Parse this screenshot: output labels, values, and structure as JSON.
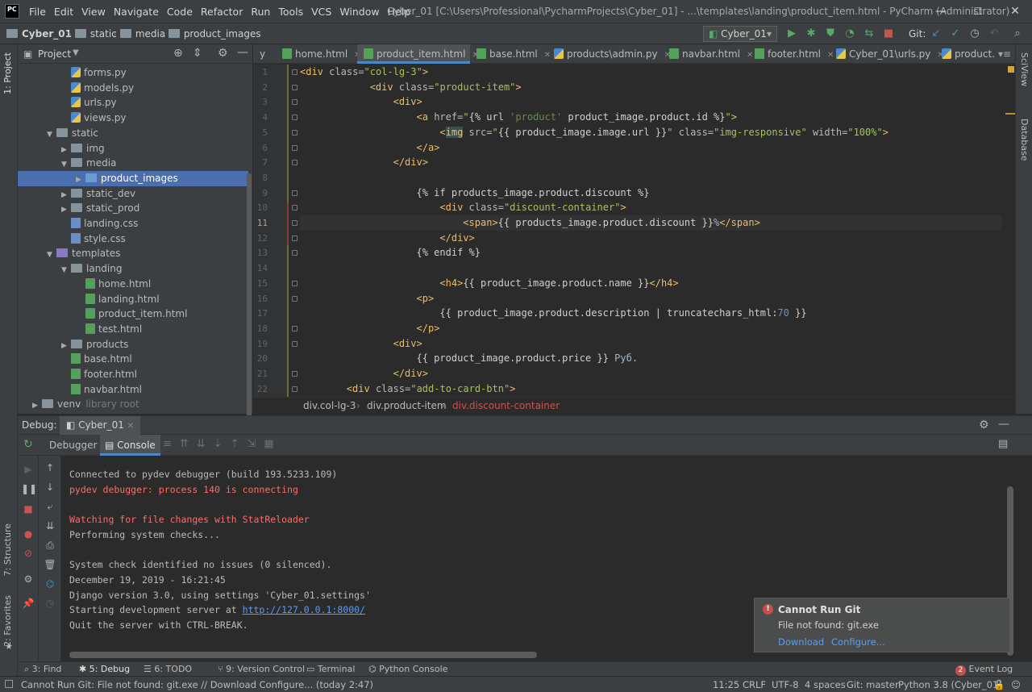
{
  "window": {
    "logo": "PC",
    "title": "Cyber_01 [C:\\Users\\Professional\\PycharmProjects\\Cyber_01] - ...\\templates\\landing\\product_item.html - PyCharm (Administrator)",
    "menu": [
      "File",
      "Edit",
      "View",
      "Navigate",
      "Code",
      "Refactor",
      "Run",
      "Tools",
      "VCS",
      "Window",
      "Help"
    ],
    "controls": {
      "minimize": "—",
      "maximize": "☐",
      "close": "✕"
    }
  },
  "navbar": {
    "crumbs": [
      "Cyber_01",
      "static",
      "media",
      "product_images"
    ],
    "run_config": "Cyber_01",
    "git_label": "Git:"
  },
  "left_strip": {
    "project_tab": "1: Project",
    "structure_tab": "7: Structure",
    "favorites_tab": "2: Favorites"
  },
  "right_strip": {
    "sciview_tab": "SciView",
    "database_tab": "Database"
  },
  "project": {
    "header": "Project",
    "tree": [
      {
        "label": "forms.py",
        "type": "py",
        "indent": 2,
        "arrow": ""
      },
      {
        "label": "models.py",
        "type": "py",
        "indent": 2,
        "arrow": ""
      },
      {
        "label": "urls.py",
        "type": "py",
        "indent": 2,
        "arrow": ""
      },
      {
        "label": "views.py",
        "type": "py",
        "indent": 2,
        "arrow": ""
      },
      {
        "label": "static",
        "type": "folder",
        "indent": 1,
        "arrow": "▼"
      },
      {
        "label": "img",
        "type": "folder",
        "indent": 2,
        "arrow": "▶"
      },
      {
        "label": "media",
        "type": "folder",
        "indent": 2,
        "arrow": "▼"
      },
      {
        "label": "product_images",
        "type": "folder-blue",
        "indent": 3,
        "arrow": "▶",
        "selected": true
      },
      {
        "label": "static_dev",
        "type": "folder",
        "indent": 2,
        "arrow": "▶"
      },
      {
        "label": "static_prod",
        "type": "folder",
        "indent": 2,
        "arrow": "▶"
      },
      {
        "label": "landing.css",
        "type": "css",
        "indent": 2,
        "arrow": ""
      },
      {
        "label": "style.css",
        "type": "css",
        "indent": 2,
        "arrow": ""
      },
      {
        "label": "templates",
        "type": "folder-purple",
        "indent": 1,
        "arrow": "▼"
      },
      {
        "label": "landing",
        "type": "folder",
        "indent": 2,
        "arrow": "▼"
      },
      {
        "label": "home.html",
        "type": "html",
        "indent": 3,
        "arrow": ""
      },
      {
        "label": "landing.html",
        "type": "html",
        "indent": 3,
        "arrow": ""
      },
      {
        "label": "product_item.html",
        "type": "html",
        "indent": 3,
        "arrow": ""
      },
      {
        "label": "test.html",
        "type": "html",
        "indent": 3,
        "arrow": ""
      },
      {
        "label": "products",
        "type": "folder",
        "indent": 2,
        "arrow": "▶"
      },
      {
        "label": "base.html",
        "type": "html",
        "indent": 2,
        "arrow": ""
      },
      {
        "label": "footer.html",
        "type": "html",
        "indent": 2,
        "arrow": ""
      },
      {
        "label": "navbar.html",
        "type": "html",
        "indent": 2,
        "arrow": ""
      },
      {
        "label": "venv",
        "type": "folder",
        "indent": 0,
        "arrow": "▶",
        "suffix": "library root"
      }
    ]
  },
  "editor": {
    "tabs": [
      {
        "label": "y",
        "active": false
      },
      {
        "label": "home.html",
        "active": false
      },
      {
        "label": "product_item.html",
        "active": true
      },
      {
        "label": "base.html",
        "active": false
      },
      {
        "label": "products\\admin.py",
        "active": false
      },
      {
        "label": "navbar.html",
        "active": false
      },
      {
        "label": "footer.html",
        "active": false
      },
      {
        "label": "Cyber_01\\urls.py",
        "active": false
      },
      {
        "label": "product.",
        "active": false
      }
    ],
    "tabs_overflow": "▾≡",
    "current_line": 11,
    "lines": [
      "<div class=\"col-lg-3\">",
      "            <div class=\"product-item\">",
      "                <div>",
      "                    <a href=\"{% url 'product' product_image.product.id %}\">",
      "                        <img src=\"{{ product_image.image.url }}\" class=\"img-responsive\" width=\"100%\">",
      "                    </a>",
      "                </div>",
      "",
      "                    {% if products_image.product.discount %}",
      "                        <div class=\"discount-container\">",
      "                            <span>{{ products_image.product.discount }}%</span>",
      "                        </div>",
      "                    {% endif %}",
      "",
      "                        <h4>{{ product_image.product.name }}</h4>",
      "                    <p>",
      "                        {{ product_image.product.description | truncatechars_html:70 }}",
      "                    </p>",
      "                <div>",
      "                    {{ product_image.product.price }} Руб.",
      "                </div>",
      "        <div class=\"add-to-card-btn\">"
    ],
    "breadcrumb": [
      "div.col-lg-3",
      "div.product-item",
      "div.discount-container"
    ]
  },
  "debug": {
    "label": "Debug:",
    "session": "Cyber_01",
    "tabs": [
      "Debugger",
      "Console"
    ],
    "active_tab": "Console",
    "console": [
      {
        "text": "Connected to pydev debugger (build 193.5233.109)",
        "err": false
      },
      {
        "text": "pydev debugger: process 140 is connecting",
        "err": true
      },
      {
        "text": "",
        "err": false
      },
      {
        "text": "Watching for file changes with StatReloader",
        "err": true
      },
      {
        "text": "Performing system checks...",
        "err": false
      },
      {
        "text": "",
        "err": false
      },
      {
        "text": "System check identified no issues (0 silenced).",
        "err": false
      },
      {
        "text": "December 19, 2019 - 16:21:45",
        "err": false
      },
      {
        "text": "Django version 3.0, using settings 'Cyber_01.settings'",
        "err": false
      },
      {
        "text": "Starting development server at ",
        "err": false,
        "link": "http://127.0.0.1:8000/"
      },
      {
        "text": "Quit the server with CTRL-BREAK.",
        "err": false
      }
    ]
  },
  "notification": {
    "badge": "!",
    "title": "Cannot Run Git",
    "body": "File not found: git.exe",
    "download": "Download",
    "configure": "Configure..."
  },
  "tool_tabs": [
    {
      "label": "3: Find",
      "icon": "🔍"
    },
    {
      "label": "5: Debug",
      "icon": "🐞",
      "active": true
    },
    {
      "label": "6: TODO",
      "icon": "☰"
    },
    {
      "label": "9: Version Control",
      "icon": "⑂"
    },
    {
      "label": "Terminal",
      "icon": "▭"
    },
    {
      "label": "Python Console",
      "icon": "⌁"
    }
  ],
  "event_log": {
    "count": "2",
    "label": "Event Log"
  },
  "status": {
    "message": "Cannot Run Git: File not found: git.exe // Download   Configure... (today 2:47)",
    "position": "11:25",
    "line_sep": "CRLF",
    "encoding": "UTF-8",
    "indent": "4 spaces",
    "branch": "Git: master",
    "interpreter": "Python 3.8 (Cyber_01)"
  },
  "colors": {
    "selection": "#4b6eaf",
    "accent": "#4a88c7",
    "error": "#ff6b68",
    "run": "#59a869"
  }
}
